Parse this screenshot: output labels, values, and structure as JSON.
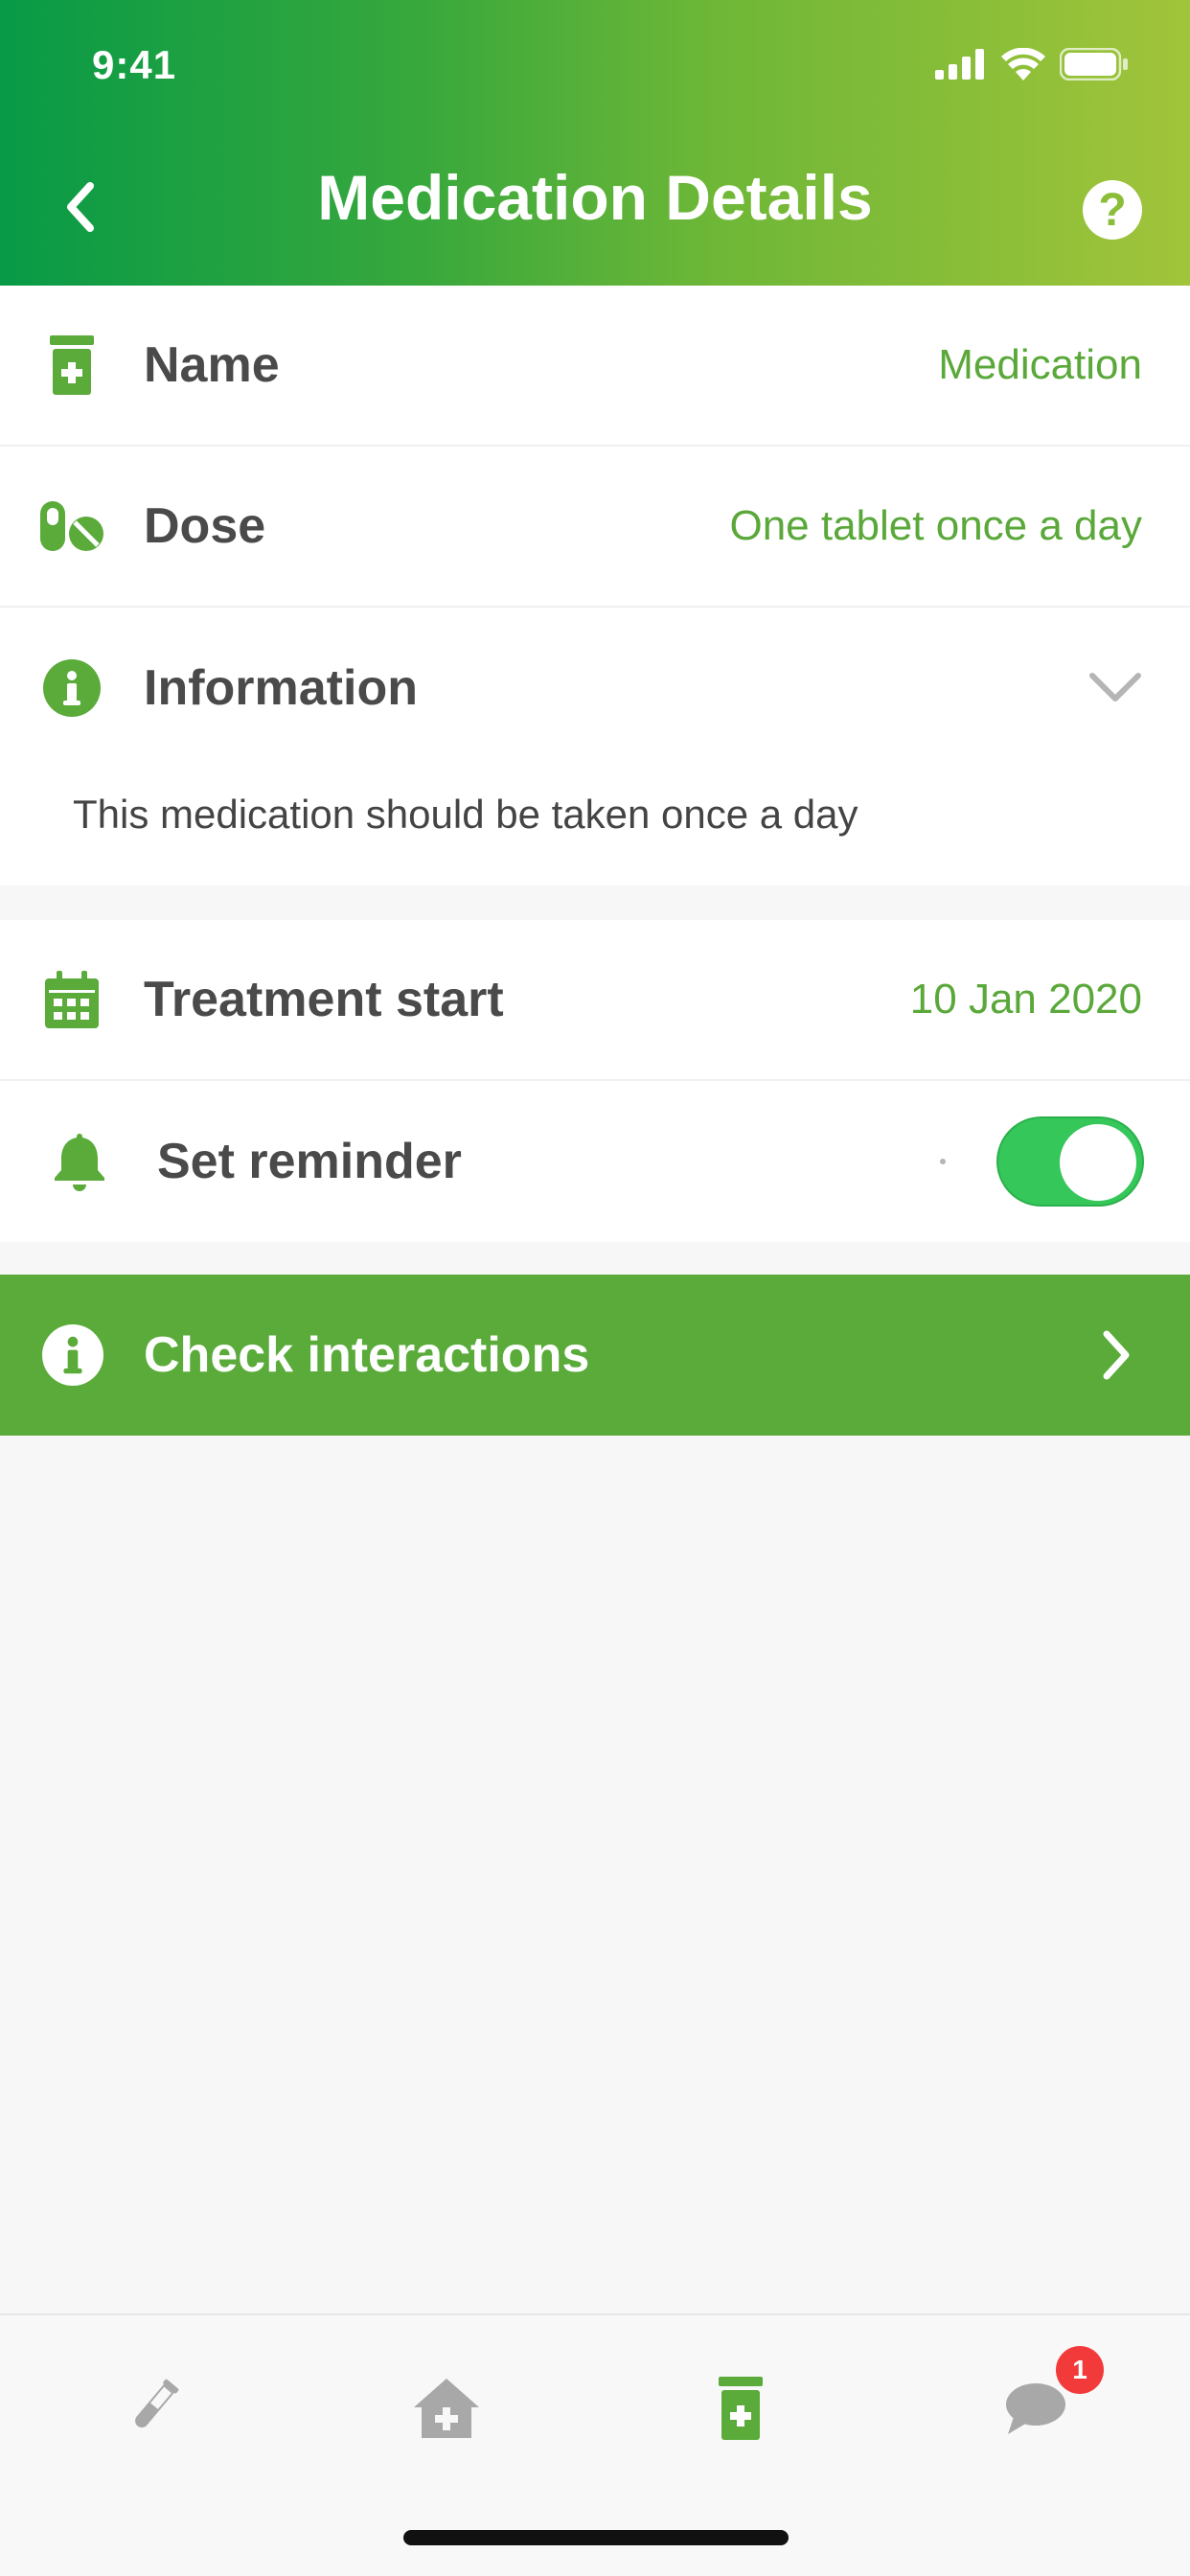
{
  "status_bar": {
    "time": "9:41"
  },
  "header": {
    "title": "Medication Details"
  },
  "details": {
    "name": {
      "label": "Name",
      "value": "Medication"
    },
    "dose": {
      "label": "Dose",
      "value": "One tablet once a day"
    },
    "information": {
      "label": "Information",
      "text": "This medication should be taken once a day"
    }
  },
  "schedule": {
    "treatment_start": {
      "label": "Treatment start",
      "value": "10 Jan 2020"
    },
    "reminder": {
      "label": "Set reminder",
      "enabled": true
    }
  },
  "actions": {
    "check_interactions": "Check interactions"
  },
  "tabbar": {
    "items": [
      {
        "icon": "test-tube-icon"
      },
      {
        "icon": "clinic-home-icon"
      },
      {
        "icon": "medication-icon",
        "active": true
      },
      {
        "icon": "chat-icon",
        "badge": "1"
      }
    ]
  },
  "colors": {
    "accent": "#5aab3a",
    "value_text": "#5aa83a",
    "toggle_on": "#35c759",
    "badge": "#f23a3a",
    "inactive_icon": "#a8a8a8"
  }
}
